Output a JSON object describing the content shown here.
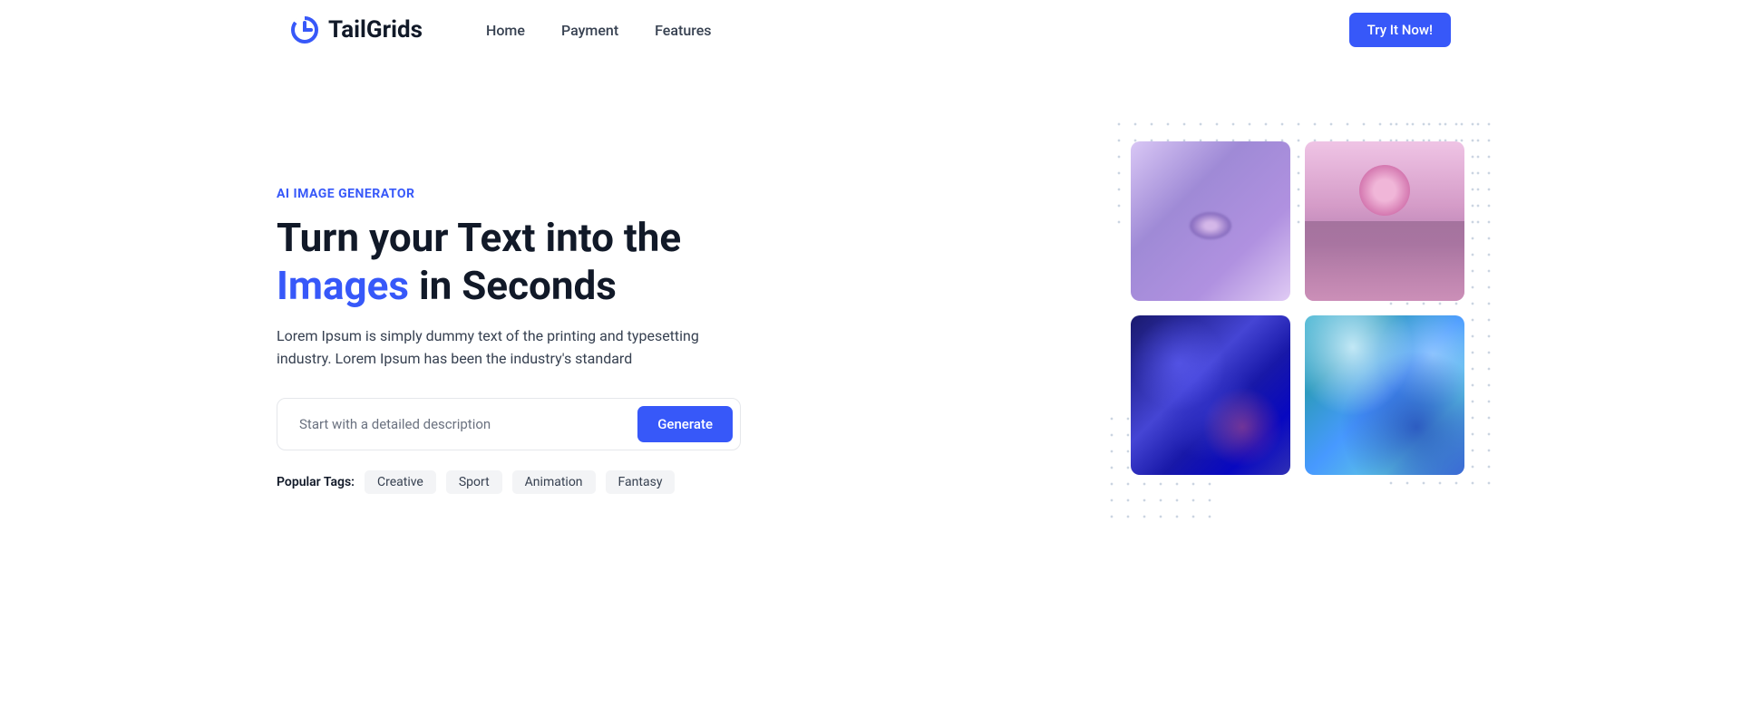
{
  "brand": "TailGrids",
  "nav": [
    "Home",
    "Payment",
    "Features"
  ],
  "cta": "Try It Now!",
  "hero": {
    "subtitle": "AI IMAGE GENERATOR",
    "title_part1": "Turn your Text into the ",
    "title_highlight": "Images",
    "title_part2": " in Seconds",
    "description": "Lorem Ipsum is simply dummy text of the printing and typesetting industry. Lorem Ipsum has been the industry's standard",
    "input_placeholder": "Start with a detailed description",
    "generate_label": "Generate",
    "tags_label": "Popular Tags:",
    "tags": [
      "Creative",
      "Sport",
      "Animation",
      "Fantasy"
    ]
  }
}
